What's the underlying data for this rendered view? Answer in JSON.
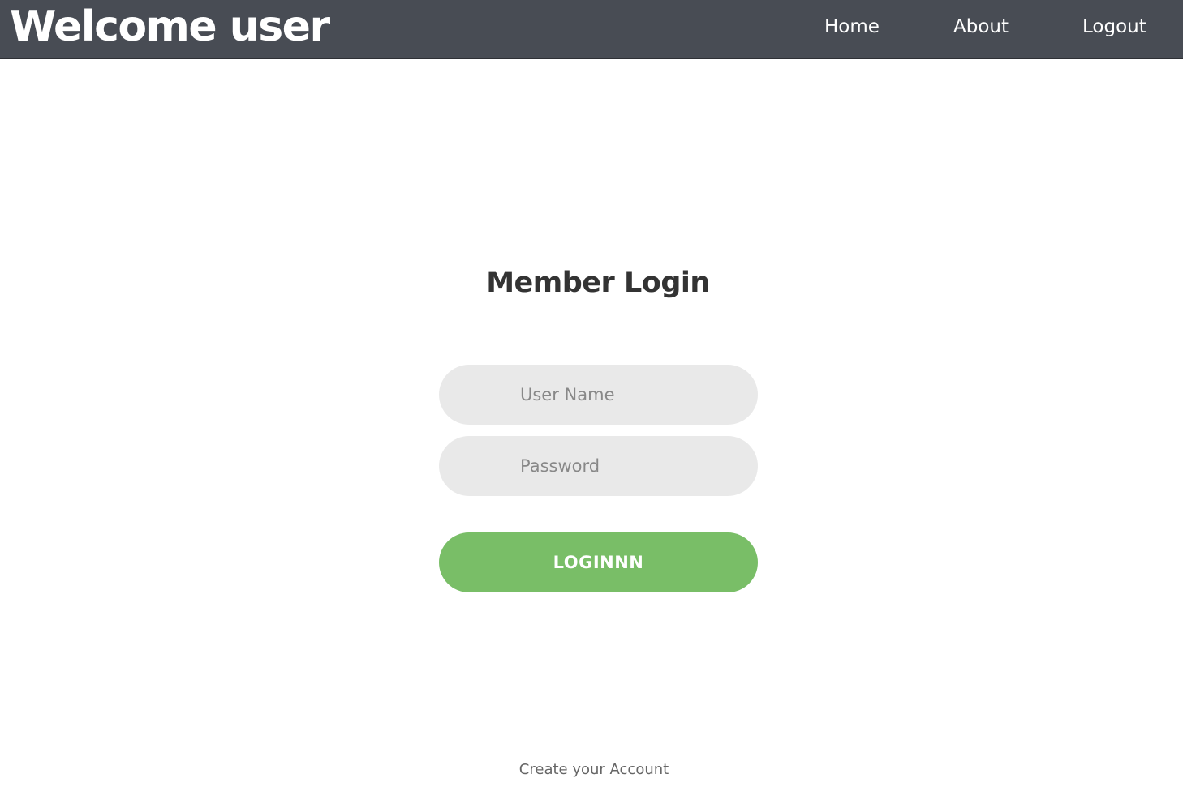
{
  "header": {
    "title": "Welcome user",
    "nav": {
      "home": "Home",
      "about": "About",
      "logout": "Logout"
    }
  },
  "login": {
    "title": "Member Login",
    "username": {
      "value": "",
      "placeholder": "User Name"
    },
    "password": {
      "value": "",
      "placeholder": "Password"
    },
    "button_label": "LOGINNN",
    "create_account": "Create your Account"
  },
  "colors": {
    "header_bg": "#484c54",
    "button_bg": "#79be67",
    "field_bg": "#e9e9e9",
    "title_text": "#333333"
  }
}
